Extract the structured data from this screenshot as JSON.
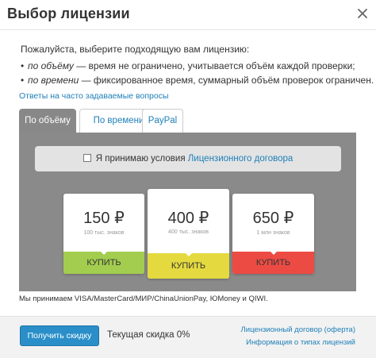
{
  "dialog": {
    "title": "Выбор лицензии",
    "close_icon": "close-icon"
  },
  "intro": {
    "text": "Пожалуйста, выберите подходящую вам лицензию:",
    "bullets": [
      {
        "mark": "•",
        "term": "по объёму",
        "desc": " — время не ограничено, учитывается объём каждой проверки;"
      },
      {
        "mark": "•",
        "term": "по времени",
        "desc": " — фиксированное время, суммарный объём проверок ограничен."
      }
    ]
  },
  "faq_link": "Ответы на часто задаваемые вопросы",
  "tabs": [
    {
      "label": "По объёму",
      "active": true
    },
    {
      "label": "По времени",
      "active": false
    },
    {
      "label": "PayPal",
      "active": false
    }
  ],
  "agreement": {
    "checked": false,
    "text": "Я принимаю условия ",
    "link": "Лицензионного договора"
  },
  "plans": [
    {
      "price": "150 ₽",
      "quantity": "100 тыс. знаков",
      "buy_label": "КУПИТЬ",
      "color": "#a3cd4e"
    },
    {
      "price": "400 ₽",
      "quantity": "400 тыс. знаков",
      "buy_label": "КУПИТЬ",
      "color": "#e4da40"
    },
    {
      "price": "650 ₽",
      "quantity": "1 млн знаков",
      "buy_label": "КУПИТЬ",
      "color": "#ec4b44"
    }
  ],
  "payment_note": "Мы принимаем VISA/MasterCard/МИР/ChinaUnionPay, ЮMoney и QIWI.",
  "footer": {
    "discount_button": "Получить скидку",
    "current_discount": "Текущая скидка 0%",
    "links": [
      "Лицензионный договор (оферта)",
      "Информация о типах лицензий"
    ]
  },
  "colors": {
    "accent": "#1e7fb8",
    "button": "#2a8fc9",
    "panel": "#8a8a8a"
  }
}
